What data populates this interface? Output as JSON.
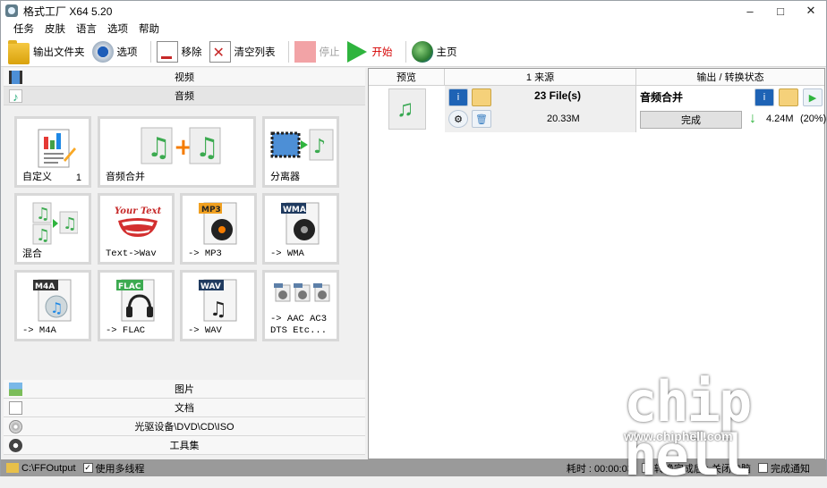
{
  "window": {
    "title": "格式工厂 X64 5.20",
    "controls": [
      "–",
      "□",
      "✕"
    ]
  },
  "menu": [
    "任务",
    "皮肤",
    "语言",
    "选项",
    "帮助"
  ],
  "toolbar": {
    "output_folder": "输出文件夹",
    "options": "选项",
    "remove": "移除",
    "clear_list": "清空列表",
    "stop": "停止",
    "start": "开始",
    "home": "主页"
  },
  "categories": {
    "video": "视频",
    "audio": "音频",
    "picture": "图片",
    "document": "文档",
    "optical": "光驱设备\\DVD\\CD\\ISO",
    "tools": "工具集"
  },
  "tiles": [
    {
      "label": "自定义",
      "badge": "1",
      "icon": "custom-icon"
    },
    {
      "label": "音频合并",
      "icon": "audio-merge-icon"
    },
    {
      "label": "分离器",
      "icon": "splitter-icon"
    },
    {
      "label": "混合",
      "icon": "mix-icon"
    },
    {
      "label": "Text->Wav",
      "icon": "text-to-wav-icon",
      "art_text": "Your Text"
    },
    {
      "label": "-> MP3",
      "icon": "mp3-icon",
      "badge_text": "MP3"
    },
    {
      "label": "-> WMA",
      "icon": "wma-icon",
      "badge_text": "WMA"
    },
    {
      "label": "-> M4A",
      "icon": "m4a-icon",
      "badge_text": "M4A"
    },
    {
      "label": "-> FLAC",
      "icon": "flac-icon",
      "badge_text": "FLAC"
    },
    {
      "label": "-> WAV",
      "icon": "wav-icon",
      "badge_text": "WAV"
    },
    {
      "label": "-> AAC AC3\nDTS Etc...",
      "icon": "other-formats-icon"
    }
  ],
  "table": {
    "headers": {
      "preview": "预览",
      "source": "1 来源",
      "output": "输出 / 转换状态"
    },
    "row": {
      "source_count": "23 File(s)",
      "source_size": "20.33M",
      "output_title": "音频合并",
      "status": "完成",
      "output_size": "4.24M",
      "output_ratio": "(20%)"
    }
  },
  "status": {
    "output_path": "C:\\FFOutput",
    "multithread": "使用多线程",
    "elapsed": "耗时 : 00:00:03",
    "after_convert": "转换完成后 : 关闭电脑",
    "notify": "完成通知"
  },
  "watermark": {
    "url": "www.chiphell.com",
    "logo": "chip hell"
  }
}
